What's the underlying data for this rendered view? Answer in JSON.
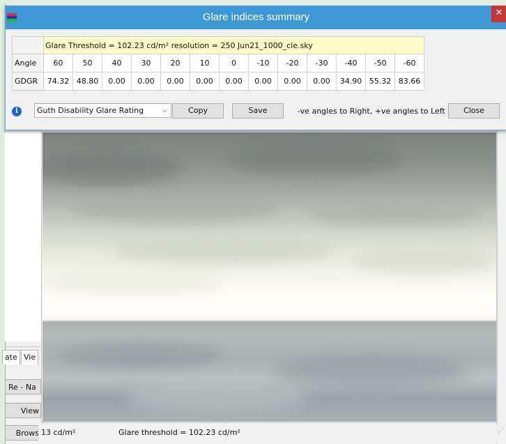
{
  "dialog": {
    "title": "Glare indices summary",
    "close_glyph": "✕",
    "info_line": "Glare Threshold = 102.23 cd/m²    resolution = 250    Jun21_1000_cie.sky",
    "table": {
      "header_label": "Angle",
      "angles": [
        "60",
        "50",
        "40",
        "30",
        "20",
        "10",
        "0",
        "-10",
        "-20",
        "-30",
        "-40",
        "-50",
        "-60"
      ],
      "row_label": "GDGR",
      "values": [
        "74.32",
        "48.80",
        "0.00",
        "0.00",
        "0.00",
        "0.00",
        "0.00",
        "0.00",
        "0.00",
        "0.00",
        "34.90",
        "55.32",
        "83.66"
      ]
    },
    "rating_select": "Guth Disability Glare Rating",
    "copy_label": "Copy",
    "save_label": "Save",
    "hint": "-ve angles to Right,  +ve angles to Left",
    "close_label": "Close"
  },
  "background": {
    "tab_1": "ate",
    "tab_2": "Vie",
    "btn_1": "Re - Na",
    "btn_2": "View",
    "btn_3": "Brows"
  },
  "status": {
    "luminance": "13 cd/m²",
    "threshold": "Glare threshold =  102.23 cd/m²"
  },
  "colors": {
    "titlebar": "#3d97d5",
    "close_button": "#c7373a",
    "info_row": "#fffbc8"
  }
}
